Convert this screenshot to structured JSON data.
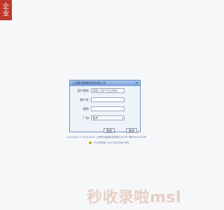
{
  "tag": {
    "line1": "企",
    "line2": "业"
  },
  "dialog": {
    "title": "上海泰鸿智能科技有限公司",
    "close_glyph": "×",
    "fields": {
      "username_label": "用户密码:",
      "username_placeholder": "请输入用户名及密码",
      "account_label": "帐户名:",
      "password_label": "密码:",
      "factory_label": "厂别:",
      "factory_value": "泰鸿",
      "dropdown_arrow": "▾"
    },
    "buttons": {
      "login": "登录",
      "cancel": "取消"
    }
  },
  "footer": {
    "copyright": "Copyright © 2014-2019 上海泰鸿智能科技有限公司 沪ICP备19020003号",
    "beian": "沪公网安备 31011302006158号"
  },
  "watermark": "秒收录啦msl"
}
